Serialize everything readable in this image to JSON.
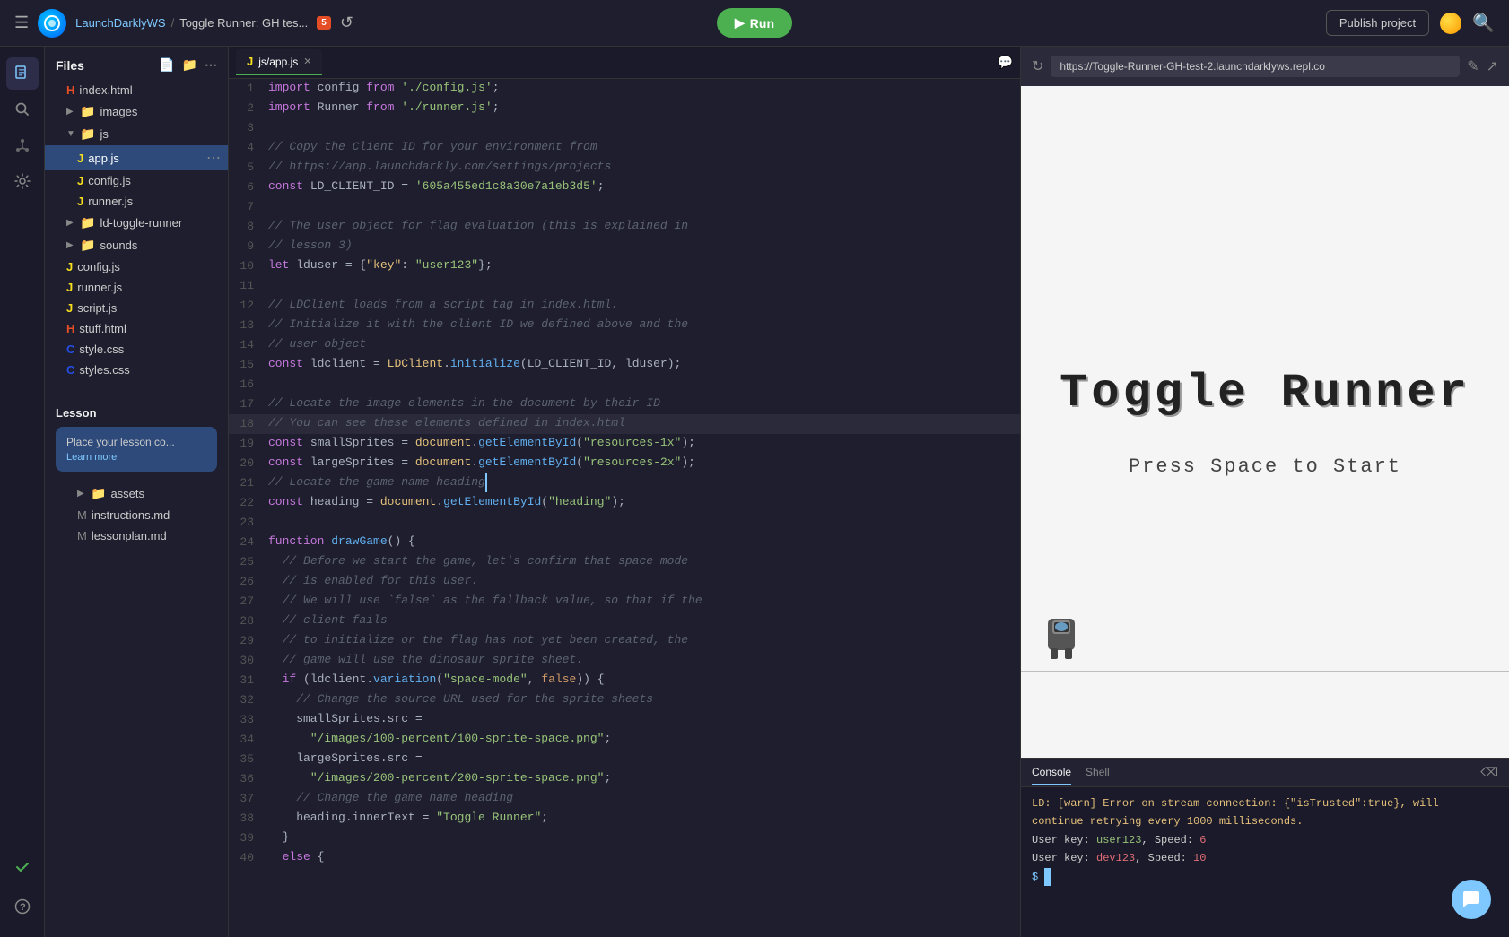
{
  "topbar": {
    "hamburger": "☰",
    "project_name": "LaunchDarklyWS",
    "separator": "/",
    "file_name": "Toggle Runner: GH tes...",
    "html5_badge": "5",
    "run_label": "Run",
    "publish_label": "Publish project"
  },
  "sidebar": {
    "title": "Files",
    "items": [
      {
        "type": "file",
        "name": "index.html",
        "ext": "html",
        "indent": 1,
        "collapsed": false
      },
      {
        "type": "folder",
        "name": "images",
        "indent": 1,
        "open": false
      },
      {
        "type": "folder",
        "name": "js",
        "indent": 1,
        "open": true
      },
      {
        "type": "file",
        "name": "app.js",
        "ext": "js",
        "indent": 2,
        "selected": true
      },
      {
        "type": "file",
        "name": "config.js",
        "ext": "js",
        "indent": 2
      },
      {
        "type": "file",
        "name": "runner.js",
        "ext": "js",
        "indent": 2
      },
      {
        "type": "folder",
        "name": "ld-toggle-runner",
        "indent": 1,
        "open": false
      },
      {
        "type": "folder",
        "name": "sounds",
        "indent": 1,
        "open": false
      },
      {
        "type": "file",
        "name": "config.js",
        "ext": "js",
        "indent": 1
      },
      {
        "type": "file",
        "name": "runner.js",
        "ext": "js",
        "indent": 1
      },
      {
        "type": "file",
        "name": "script.js",
        "ext": "js",
        "indent": 1
      },
      {
        "type": "file",
        "name": "stuff.html",
        "ext": "html",
        "indent": 1
      },
      {
        "type": "file",
        "name": "style.css",
        "ext": "css",
        "indent": 1
      },
      {
        "type": "file",
        "name": "styles.css",
        "ext": "css",
        "indent": 1
      }
    ],
    "lesson": {
      "title": "Lesson",
      "banner_title": "Place your lesson co...",
      "banner_learn": "Learn more",
      "subitems": [
        {
          "type": "folder",
          "name": "assets",
          "indent": 1
        },
        {
          "type": "file",
          "name": "instructions.md",
          "ext": "md",
          "indent": 1
        },
        {
          "type": "file",
          "name": "lessonplan.md",
          "ext": "md",
          "indent": 1
        }
      ]
    }
  },
  "editor": {
    "tab_label": "js/app.js",
    "lines": [
      {
        "n": 1,
        "code": "import config from './config.js';"
      },
      {
        "n": 2,
        "code": "import Runner from './runner.js';"
      },
      {
        "n": 3,
        "code": ""
      },
      {
        "n": 4,
        "code": "// Copy the Client ID for your environment from"
      },
      {
        "n": 5,
        "code": "// https://app.launchdarkly.com/settings/projects"
      },
      {
        "n": 6,
        "code": "const LD_CLIENT_ID = '605a455ed1c8a30e7a1eb3d5';"
      },
      {
        "n": 7,
        "code": ""
      },
      {
        "n": 8,
        "code": "// The user object for flag evaluation (this is explained in"
      },
      {
        "n": 9,
        "code": "// lesson 3)"
      },
      {
        "n": 10,
        "code": "let lduser = {\"key\": \"user123\"};"
      },
      {
        "n": 11,
        "code": ""
      },
      {
        "n": 12,
        "code": "// LDClient loads from a script tag in index.html."
      },
      {
        "n": 13,
        "code": "// Initialize it with the client ID we defined above and the"
      },
      {
        "n": 14,
        "code": "// user object"
      },
      {
        "n": 15,
        "code": "const ldclient = LDClient.initialize(LD_CLIENT_ID, lduser);"
      },
      {
        "n": 16,
        "code": ""
      },
      {
        "n": 17,
        "code": "// Locate the image elements in the document by their ID"
      },
      {
        "n": 18,
        "code": "// You can see these elements defined in index.html"
      },
      {
        "n": 19,
        "code": "const smallSprites = document.getElementById(\"resources-1x\");"
      },
      {
        "n": 20,
        "code": "const largeSprites = document.getElementById(\"resources-2x\");"
      },
      {
        "n": 21,
        "code": "// Locate the game name heading_"
      },
      {
        "n": 22,
        "code": "const heading = document.getElementById(\"heading\");"
      },
      {
        "n": 23,
        "code": ""
      },
      {
        "n": 24,
        "code": "function drawGame() {"
      },
      {
        "n": 25,
        "code": "  // Before we start the game, let's confirm that space mode"
      },
      {
        "n": 26,
        "code": "  // is enabled for this user."
      },
      {
        "n": 27,
        "code": "  // We will use `false` as the fallback value, so that if the"
      },
      {
        "n": 28,
        "code": "  // client fails"
      },
      {
        "n": 29,
        "code": "  // to initialize or the flag has not yet been created, the"
      },
      {
        "n": 30,
        "code": "  // game will use the dinosaur sprite sheet."
      },
      {
        "n": 31,
        "code": "  if (ldclient.variation(\"space-mode\", false)) {"
      },
      {
        "n": 32,
        "code": "    // Change the source URL used for the sprite sheets"
      },
      {
        "n": 33,
        "code": "    smallSprites.src ="
      },
      {
        "n": 34,
        "code": "      \"/images/100-percent/100-sprite-space.png\";"
      },
      {
        "n": 35,
        "code": "    largeSprites.src ="
      },
      {
        "n": 36,
        "code": "      \"/images/200-percent/200-sprite-space.png\";"
      },
      {
        "n": 37,
        "code": "    // Change the game name heading"
      },
      {
        "n": 38,
        "code": "    heading.innerText = \"Toggle Runner\";"
      },
      {
        "n": 39,
        "code": "  }"
      },
      {
        "n": 40,
        "code": "  else {"
      }
    ]
  },
  "preview": {
    "url": "https://Toggle-Runner-GH-test-2.launchdarklyws.repl.co",
    "game_title": "Toggle Runner",
    "press_space": "Press Space to Start"
  },
  "console": {
    "tabs": [
      "Console",
      "Shell"
    ],
    "active_tab": "Console",
    "lines": [
      {
        "type": "warn",
        "text": "LD: [warn] Error on stream connection: {\"isTrusted\":true}, will"
      },
      {
        "type": "warn",
        "text": "continue retrying every 1000 milliseconds."
      },
      {
        "type": "normal",
        "text": "User key: ",
        "highlight": "user123",
        "rest": ", Speed: ",
        "speed": "6"
      },
      {
        "type": "normal",
        "text": "User key: ",
        "highlight2": "dev123",
        "rest": ", Speed: ",
        "speed": "10"
      },
      {
        "type": "prompt",
        "text": "$ "
      }
    ]
  }
}
